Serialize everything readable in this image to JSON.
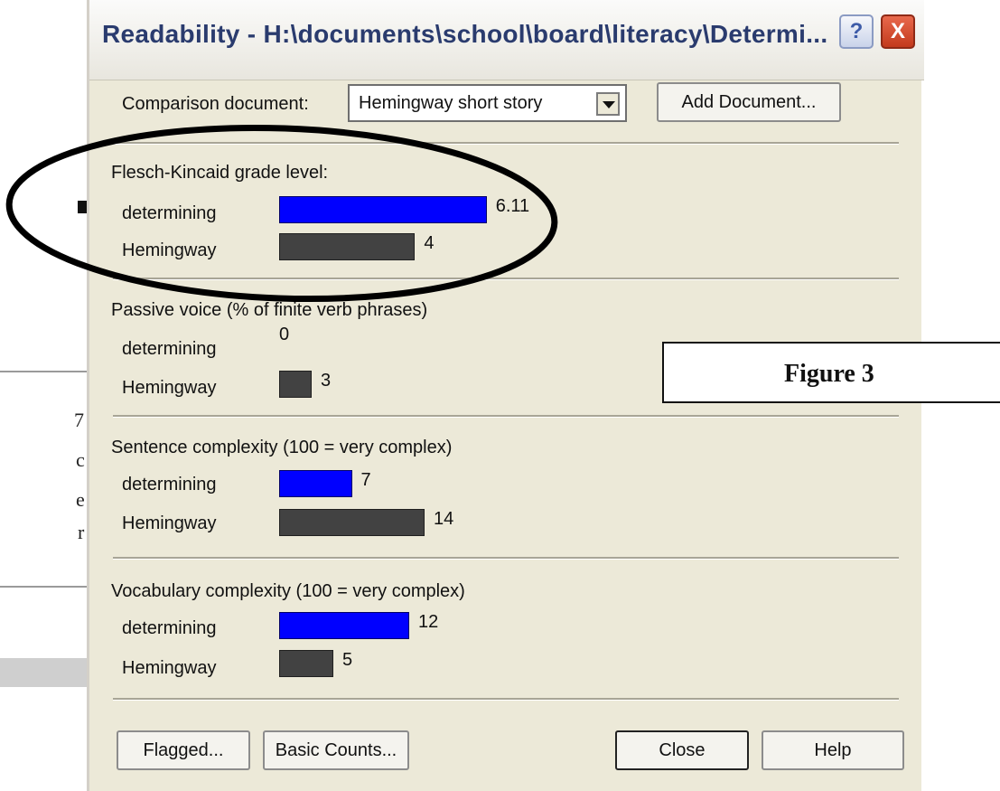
{
  "window": {
    "title": "Readability - H:\\documents\\school\\board\\literacy\\Determi...",
    "help_glyph": "?",
    "close_glyph": "X"
  },
  "background_doc": {
    "glyphs": [
      "7",
      "c",
      "e",
      "r"
    ]
  },
  "comparison": {
    "label": "Comparison document:",
    "selected": "Hemingway short story",
    "add_button": "Add Document..."
  },
  "sections": [
    {
      "title": "Flesch-Kincaid grade level:",
      "rows": [
        {
          "label": "determining",
          "value": 6.11,
          "value_text": "6.11",
          "color": "#0000ff"
        },
        {
          "label": "Hemingway",
          "value": 4,
          "value_text": "4",
          "color": "#424242"
        }
      ]
    },
    {
      "title": "Passive voice (% of finite verb phrases)",
      "rows": [
        {
          "label": "determining",
          "value": 0,
          "value_text": "0",
          "color": "#0000ff"
        },
        {
          "label": "Hemingway",
          "value": 3,
          "value_text": "3",
          "color": "#424242"
        }
      ]
    },
    {
      "title": "Sentence complexity (100 = very complex)",
      "rows": [
        {
          "label": "determining",
          "value": 7,
          "value_text": "7",
          "color": "#0000ff"
        },
        {
          "label": "Hemingway",
          "value": 14,
          "value_text": "14",
          "color": "#424242"
        }
      ]
    },
    {
      "title": "Vocabulary complexity (100 = very complex)",
      "rows": [
        {
          "label": "determining",
          "value": 12,
          "value_text": "12",
          "color": "#0000ff"
        },
        {
          "label": "Hemingway",
          "value": 5,
          "value_text": "5",
          "color": "#424242"
        }
      ]
    }
  ],
  "buttons": {
    "flagged": "Flagged...",
    "basic_counts": "Basic Counts...",
    "close": "Close",
    "help": "Help"
  },
  "figure_label": "Figure 3",
  "colors": {
    "accent_blue": "#0000ff",
    "comparison_gray": "#424242",
    "dialog_bg": "#ece9d8"
  }
}
